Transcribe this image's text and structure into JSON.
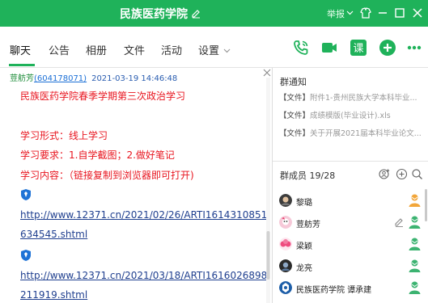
{
  "window": {
    "title": "民族医药学院",
    "report_label": "举报",
    "accent": "#1fb25a"
  },
  "tabs": [
    {
      "label": "聊天",
      "active": true
    },
    {
      "label": "公告"
    },
    {
      "label": "相册"
    },
    {
      "label": "文件"
    },
    {
      "label": "活动"
    },
    {
      "label": "设置"
    }
  ],
  "toolbar_icons": [
    "phone-call-icon",
    "video-call-icon",
    "course-icon",
    "add-icon",
    "more-icon"
  ],
  "message": {
    "sender_name": "荳舫芳",
    "sender_id": "(604178071)",
    "time": "2021-03-19 14:46:48",
    "lines": [
      "民族医药学院春季学期第三次政治学习",
      "学习形式：线上学习",
      "学习要求：1.自学截图；2.做好笔记",
      "学习内容：（链接复制到浏览器即可打开)"
    ],
    "links": [
      {
        "line1": "http://www.12371.cn/2021/02/26/ARTI1614310851",
        "line2": "634545.shtml"
      },
      {
        "line1": "http://www.12371.cn/2021/03/18/ARTI1616026898",
        "line2": "211919.shtml"
      }
    ],
    "text_color": "#e8151f"
  },
  "notices": {
    "title": "群通知",
    "items": [
      {
        "tag": "【文件】",
        "text": "附件1-贵州民族大学本科毕业..."
      },
      {
        "tag": "【文件】",
        "text": "成绩模版(毕业设计).xls"
      },
      {
        "tag": "【文件】",
        "text": "关于开展2021届本科毕业论文..."
      }
    ]
  },
  "members": {
    "title": "群成员 19/28",
    "list": [
      {
        "name": "黎璐",
        "role": "owner"
      },
      {
        "name": "荳舫芳",
        "role": "admin",
        "editable": true
      },
      {
        "name": "梁颖",
        "role": "admin"
      },
      {
        "name": "龙亮",
        "role": "admin"
      },
      {
        "name": "民族医药学院 谭承建",
        "role": "admin"
      }
    ]
  }
}
